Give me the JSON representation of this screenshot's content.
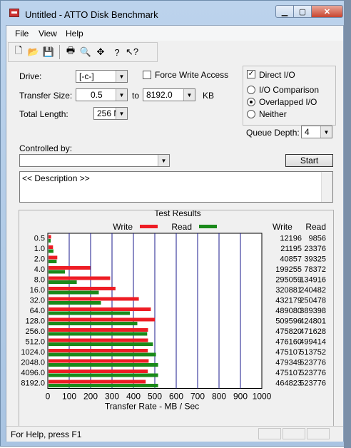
{
  "window": {
    "title": "Untitled - ATTO Disk Benchmark"
  },
  "menu": [
    "File",
    "View",
    "Help"
  ],
  "toolbar": {
    "icons": [
      "new-file-icon",
      "open-folder-icon",
      "save-icon",
      "print-icon",
      "print-preview-icon",
      "move-icon",
      "help-icon",
      "context-help-icon"
    ]
  },
  "form": {
    "drive_label": "Drive:",
    "drive_value": "[-c-]",
    "force_write_label": "Force Write Access",
    "force_write_checked": false,
    "direct_io_label": "Direct I/O",
    "direct_io_checked": true,
    "transfer_size_label": "Transfer Size:",
    "transfer_from": "0.5",
    "to_label": "to",
    "transfer_to": "8192.0",
    "kb_label": "KB",
    "total_length_label": "Total Length:",
    "total_length_value": "256 MB",
    "io_comparison_label": "I/O Comparison",
    "overlapped_io_label": "Overlapped I/O",
    "neither_label": "Neither",
    "queue_depth_label": "Queue Depth:",
    "queue_depth_value": "4",
    "controlled_by_label": "Controlled by:",
    "controlled_by_value": "",
    "start_label": "Start",
    "description_text": "<< Description >>"
  },
  "results": {
    "title": "Test Results",
    "write_legend": "Write",
    "read_legend": "Read",
    "write_col": "Write",
    "read_col": "Read",
    "xaxis_title": "Transfer Rate - MB / Sec"
  },
  "chart_data": {
    "type": "bar",
    "title": "Test Results",
    "xlabel": "Transfer Rate - MB / Sec",
    "xlim": [
      0,
      1000
    ],
    "xticks": [
      "0",
      "100",
      "200",
      "300",
      "400",
      "500",
      "600",
      "700",
      "800",
      "900",
      "1000"
    ],
    "categories": [
      "0.5",
      "1.0",
      "2.0",
      "4.0",
      "8.0",
      "16.0",
      "32.0",
      "64.0",
      "128.0",
      "256.0",
      "512.0",
      "1024.0",
      "2048.0",
      "4096.0",
      "8192.0"
    ],
    "series": [
      {
        "name": "Write",
        "color": "#ee1c24",
        "values": [
          12,
          21,
          41,
          195,
          288,
          313,
          422,
          478,
          497,
          465,
          465,
          464,
          468,
          464,
          454
        ],
        "table": [
          "12196",
          "21195",
          "40857",
          "199255",
          "295059",
          "320881",
          "432179",
          "489080",
          "509596",
          "475820",
          "476160",
          "475107",
          "479349",
          "475107",
          "464823"
        ]
      },
      {
        "name": "Read",
        "color": "#1a8a1a",
        "values": [
          10,
          23,
          38,
          77,
          132,
          235,
          245,
          380,
          415,
          461,
          488,
          502,
          512,
          512,
          512
        ],
        "table": [
          "9856",
          "23376",
          "39325",
          "78372",
          "134916",
          "240482",
          "250478",
          "389398",
          "424801",
          "471628",
          "499414",
          "513752",
          "523776",
          "523776",
          "523776"
        ]
      }
    ]
  },
  "status": {
    "text": "For Help, press F1"
  }
}
